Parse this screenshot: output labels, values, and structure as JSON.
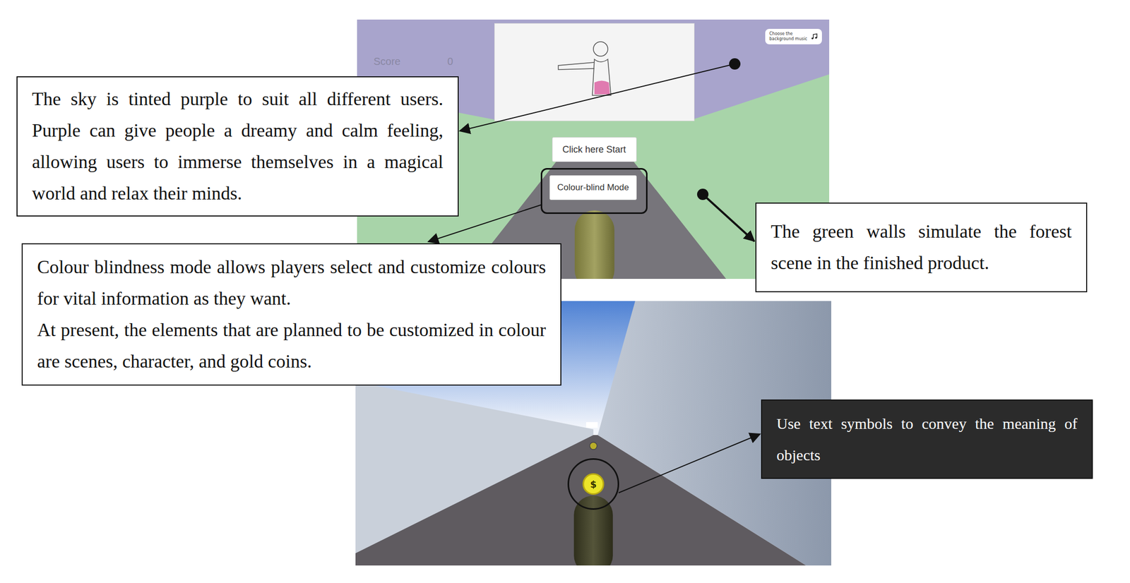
{
  "menu_screen": {
    "score_label": "Score",
    "score_value": "0",
    "music_button": "Choose the background music",
    "start_button": "Click here Start",
    "colour_blind_button": "Colour-blind Mode",
    "colour_blind_highlighted": true
  },
  "run_screen": {
    "coin_symbol": "$",
    "coin_highlighted": true
  },
  "annotations": [
    {
      "kind": "light",
      "paragraphs": [
        "The sky is tinted purple to suit all different users. Purple can give people a dreamy and calm feeling, allowing users to immerse themselves in a magical world and relax their minds."
      ]
    },
    {
      "kind": "light",
      "paragraphs": [
        "Colour blindness mode allows players select and customize colours for vital information as they want.",
        "At present, the elements that are planned to be customized in colour are scenes, character, and gold coins."
      ]
    },
    {
      "kind": "light",
      "paragraphs": [
        "The green walls simulate the forest scene in the finished product."
      ]
    },
    {
      "kind": "dark",
      "paragraphs": [
        "Use text symbols to convey the meaning of objects"
      ]
    }
  ]
}
